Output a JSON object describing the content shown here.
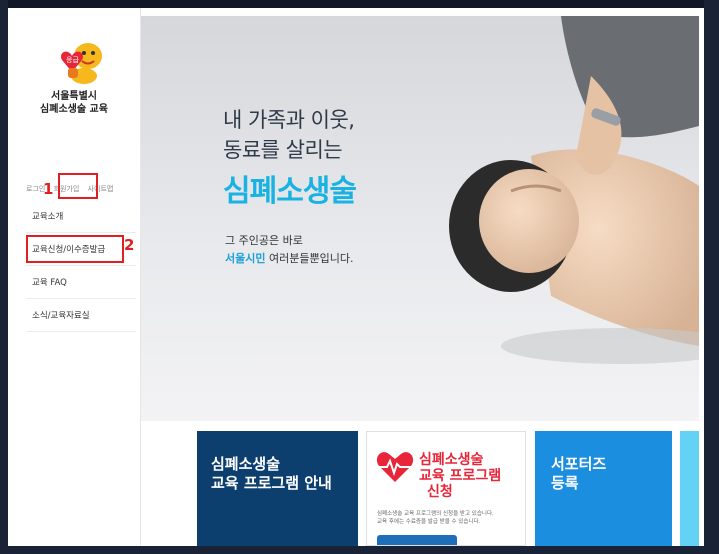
{
  "sidebar": {
    "org_line1": "서울특별시",
    "org_line2": "심폐소생술 교육",
    "util_links": [
      "로그인",
      "회원가입",
      "사이트맵"
    ],
    "nav_items": [
      "교육소개",
      "교육신청/이수증발급",
      "교육 FAQ",
      "소식/교육자료실"
    ]
  },
  "annotations": [
    "1",
    "2"
  ],
  "hero": {
    "line1": "내 가족과 이웃,",
    "line2": "동료를 살리는",
    "main": "심폐소생술",
    "sub1": "그 주인공은 바로",
    "sub2_highlight": "서울시민",
    "sub2_rest": " 여러분들뿐입니다."
  },
  "cards": {
    "c1_line1": "심폐소생술",
    "c1_line2": "교육 프로그램 안내",
    "c2_line1": "심폐소생술",
    "c2_line2": "교육 프로그램",
    "c2_line3": "신청",
    "c2_desc1": "심폐소생술 교육 프로그램의 신청을 받고 있습니다.",
    "c2_desc2": "교육 후에는 수료증을 발급 받을 수 있습니다.",
    "c3_line1": "서포터즈",
    "c3_line2": "등록"
  },
  "colors": {
    "accent": "#19b3e3",
    "highlight": "#e02020",
    "navy": "#0d3f6e",
    "blue": "#1c8ee0"
  }
}
